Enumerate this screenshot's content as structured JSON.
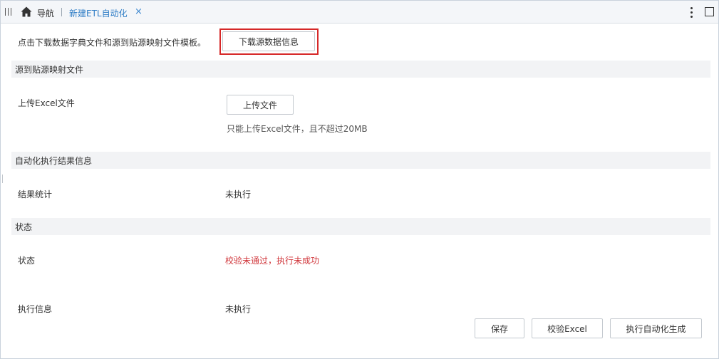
{
  "tabs": {
    "nav_label": "导航",
    "active_tab": "新建ETL自动化",
    "close_glyph": "×"
  },
  "intro": {
    "text": "点击下载数据字典文件和源到贴源映射文件模板。",
    "download_button": "下载源数据信息"
  },
  "mapping_section": {
    "header": "源到贴源映射文件",
    "upload_label": "上传Excel文件",
    "upload_button": "上传文件",
    "upload_hint": "只能上传Excel文件，且不超过20MB"
  },
  "result_section": {
    "header": "自动化执行结果信息",
    "stats_label": "结果统计",
    "stats_value": "未执行"
  },
  "status_section": {
    "header": "状态",
    "status_label": "状态",
    "status_value": "校验未通过，执行未成功",
    "exec_label": "执行信息",
    "exec_value": "未执行"
  },
  "actions": {
    "save": "保存",
    "validate": "校验Excel",
    "run": "执行自动化生成"
  },
  "colors": {
    "accent": "#2f7dc6",
    "error": "#d0363b",
    "highlight_border": "#d62828"
  }
}
